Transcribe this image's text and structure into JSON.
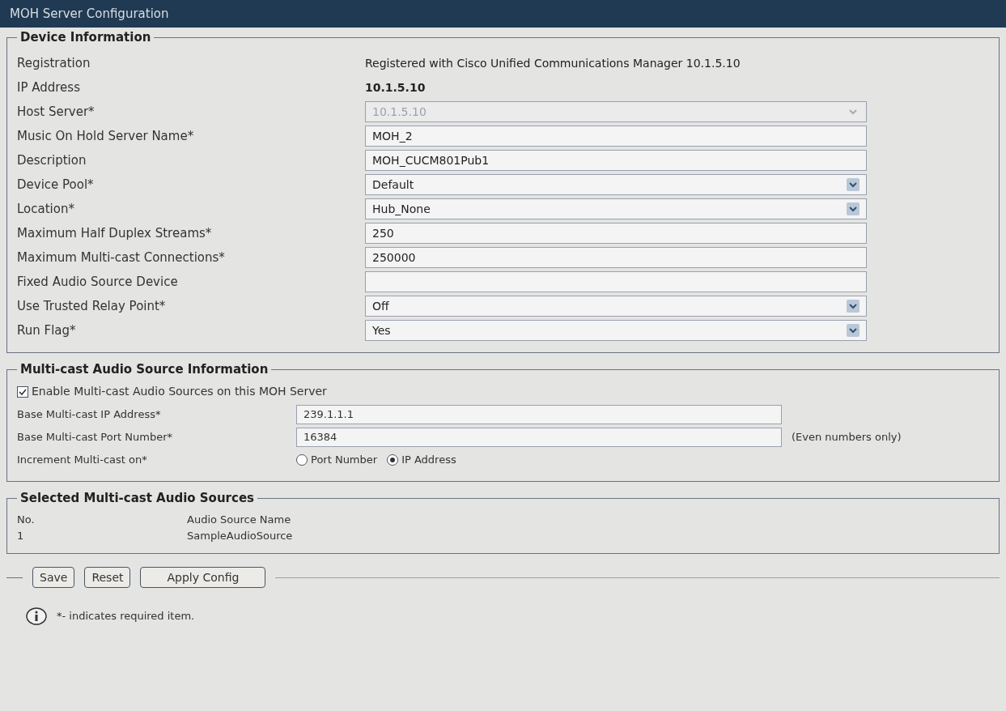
{
  "window": {
    "title": "MOH Server Configuration"
  },
  "device_information": {
    "title": "Device Information",
    "fields": [
      {
        "label": "Registration",
        "kind": "static",
        "value": "Registered with Cisco Unified Communications Manager 10.1.5.10",
        "bold": false
      },
      {
        "label": "IP Address",
        "kind": "static",
        "value": "10.1.5.10",
        "bold": true
      },
      {
        "label": "Host Server*",
        "kind": "select",
        "value": "10.1.5.10",
        "disabled": true
      },
      {
        "label": "Music On Hold Server Name*",
        "kind": "input",
        "value": "MOH_2"
      },
      {
        "label": "Description",
        "kind": "input",
        "value": "MOH_CUCM801Pub1"
      },
      {
        "label": "Device Pool*",
        "kind": "select",
        "value": "Default",
        "disabled": false
      },
      {
        "label": "Location*",
        "kind": "select",
        "value": "Hub_None",
        "disabled": false
      },
      {
        "label": "Maximum Half Duplex Streams*",
        "kind": "input",
        "value": "250"
      },
      {
        "label": "Maximum Multi-cast Connections*",
        "kind": "input",
        "value": "250000"
      },
      {
        "label": "Fixed Audio Source Device",
        "kind": "input"
      },
      {
        "label": "Use Trusted Relay Point*",
        "kind": "select",
        "value": "Off",
        "disabled": false
      },
      {
        "label": "Run Flag*",
        "kind": "select",
        "value": "Yes",
        "disabled": false
      }
    ]
  },
  "multicast_information": {
    "title": "Multi-cast Audio Source Information",
    "enable": {
      "label": "Enable Multi-cast Audio Sources on this MOH Server",
      "checked": true
    },
    "base_ip": {
      "label": "Base Multi-cast IP Address*",
      "value": "239.1.1.1"
    },
    "base_port": {
      "label": "Base Multi-cast Port Number*",
      "value": "16384",
      "hint": "(Even numbers only)"
    },
    "increment": {
      "label": "Increment Multi-cast on*",
      "options": [
        {
          "label": "Port Number",
          "selected": false
        },
        {
          "label": "IP Address",
          "selected": true
        }
      ]
    }
  },
  "selected_sources": {
    "title": "Selected Multi-cast Audio Sources",
    "columns": [
      "No.",
      "Audio Source Name"
    ],
    "rows": [
      [
        "1",
        "SampleAudioSource"
      ]
    ]
  },
  "buttons": [
    "Save",
    "Reset",
    "Apply Config"
  ],
  "note": "*- indicates required item."
}
